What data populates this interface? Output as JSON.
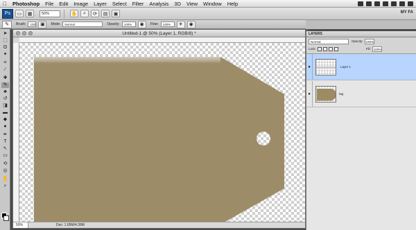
{
  "menubar": {
    "app_name": "Photoshop",
    "items": [
      "File",
      "Edit",
      "Image",
      "Layer",
      "Select",
      "Filter",
      "Analysis",
      "3D",
      "View",
      "Window",
      "Help"
    ],
    "status_right": "MY FA"
  },
  "optionsbar": {
    "logo": "Ps",
    "zoom_value": "50%",
    "workspace_label": "MY FA"
  },
  "brushbar": {
    "brush_label": "Brush:",
    "brush_size": "100",
    "mode_label": "Mode:",
    "mode_value": "Normal",
    "opacity_label": "Opacity:",
    "opacity_value": "100%",
    "flow_label": "Flow:",
    "flow_value": "100%"
  },
  "document": {
    "title": "Untitled-1 @ 50% (Layer 1, RGB/8) *",
    "status_zoom": "50%",
    "status_info": "Doc: 1.65M/4.39M"
  },
  "layers_panel": {
    "tab_label": "LAYERS",
    "blend_mode": "Normal",
    "opacity_label": "Opacity:",
    "opacity_value": "100%",
    "lock_label": "Lock:",
    "fill_label": "Fill:",
    "fill_value": "100%",
    "layers": [
      {
        "name": "Layer 1",
        "selected": true
      },
      {
        "name": "tag",
        "selected": false
      }
    ]
  },
  "colors": {
    "tag_fill": "#9d8b63",
    "selection_blue": "#b7d5ff"
  }
}
